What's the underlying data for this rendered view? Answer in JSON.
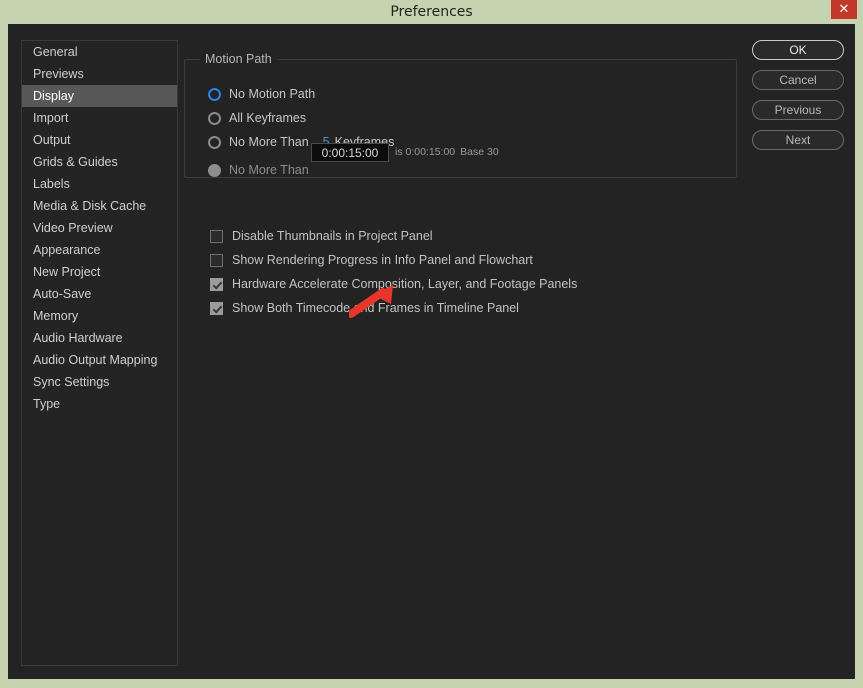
{
  "window": {
    "title": "Preferences",
    "close_label": "✕",
    "titlebar_color": "#c5d3b0",
    "close_color": "#c0392b",
    "body_color": "#232323"
  },
  "sidebar": {
    "selected": "Display",
    "items": [
      {
        "label": "General"
      },
      {
        "label": "Previews"
      },
      {
        "label": "Display"
      },
      {
        "label": "Import"
      },
      {
        "label": "Output"
      },
      {
        "label": "Grids & Guides"
      },
      {
        "label": "Labels"
      },
      {
        "label": "Media & Disk Cache"
      },
      {
        "label": "Video Preview"
      },
      {
        "label": "Appearance"
      },
      {
        "label": "New Project"
      },
      {
        "label": "Auto-Save"
      },
      {
        "label": "Memory"
      },
      {
        "label": "Audio Hardware"
      },
      {
        "label": "Audio Output Mapping"
      },
      {
        "label": "Sync Settings"
      },
      {
        "label": "Type"
      }
    ]
  },
  "motion_path": {
    "legend": "Motion Path",
    "options": [
      {
        "label": "No Motion Path",
        "checked": true,
        "disabled": false
      },
      {
        "label": "All Keyframes",
        "checked": false,
        "disabled": false
      },
      {
        "label": "No More Than",
        "checked": false,
        "disabled": false
      },
      {
        "label": "No More Than",
        "checked": false,
        "disabled": true
      }
    ],
    "keyframes_value": "5",
    "keyframes_label": "Keyframes",
    "keyframes_accent": "#4a90d9",
    "timecode_value": "0:00:15:00",
    "timecode_suffix_is": "is 0:00:15:00",
    "timecode_suffix_base": "Base 30"
  },
  "checkboxes": [
    {
      "label": "Disable Thumbnails in Project Panel",
      "checked": false
    },
    {
      "label": "Show Rendering Progress in Info Panel and Flowchart",
      "checked": false
    },
    {
      "label": "Hardware Accelerate Composition, Layer, and Footage Panels",
      "checked": true
    },
    {
      "label": "Show Both Timecode and Frames in Timeline Panel",
      "checked": true
    }
  ],
  "buttons": [
    {
      "label": "OK",
      "primary": true
    },
    {
      "label": "Cancel",
      "primary": false
    },
    {
      "label": "Previous",
      "primary": false
    },
    {
      "label": "Next",
      "primary": false
    }
  ],
  "annotation": {
    "arrow_color": "#e8362a",
    "points_at": "Hardware Accelerate Composition, Layer, and Footage Panels"
  }
}
